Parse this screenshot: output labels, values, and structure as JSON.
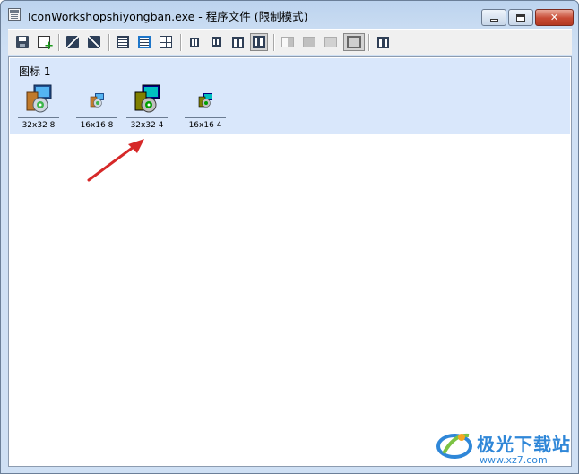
{
  "window": {
    "title": "IconWorkshopshiyongban.exe - 程序文件 (限制模式)",
    "controls": {
      "minimize": "minimize",
      "maximize": "maximize",
      "close": "✕"
    }
  },
  "toolbar": {
    "buttons": [
      {
        "name": "save",
        "icon": "save-icon"
      },
      {
        "name": "new-image",
        "icon": "add-image-icon"
      },
      {
        "name": "edit",
        "icon": "edit-icon"
      },
      {
        "name": "properties",
        "icon": "properties-icon"
      },
      {
        "name": "frame-1",
        "icon": "frame-icon"
      },
      {
        "name": "frame-2",
        "icon": "frame-color-icon"
      },
      {
        "name": "grid",
        "icon": "grid-icon"
      },
      {
        "name": "size-16",
        "icon": "size-small-icon"
      },
      {
        "name": "size-24",
        "icon": "size-small-icon"
      },
      {
        "name": "size-32",
        "icon": "size-medium-icon"
      },
      {
        "name": "size-48",
        "icon": "size-large-icon",
        "pressed": true
      },
      {
        "name": "bg-1",
        "icon": "background-icon",
        "disabled": true
      },
      {
        "name": "bg-2",
        "icon": "background-icon",
        "disabled": true
      },
      {
        "name": "bg-3",
        "icon": "background-icon",
        "disabled": true
      },
      {
        "name": "bg-4",
        "icon": "background-icon",
        "pressed": true
      },
      {
        "name": "view",
        "icon": "view-icon"
      }
    ]
  },
  "group": {
    "title": "图标 1",
    "icons": [
      {
        "label": "32x32 8",
        "size": "large",
        "icon": "installer-icon"
      },
      {
        "label": "16x16 8",
        "size": "small",
        "icon": "installer-icon"
      },
      {
        "label": "32x32 4",
        "size": "large",
        "icon": "installer-icon"
      },
      {
        "label": "16x16 4",
        "size": "small",
        "icon": "installer-icon"
      }
    ]
  },
  "annotation": {
    "arrow_color": "#d62828"
  },
  "watermark": {
    "text": "极光下载站",
    "url": "www.xz7.com"
  },
  "colors": {
    "group_bg": "#d9e7fb",
    "accent": "#2f87d8"
  }
}
